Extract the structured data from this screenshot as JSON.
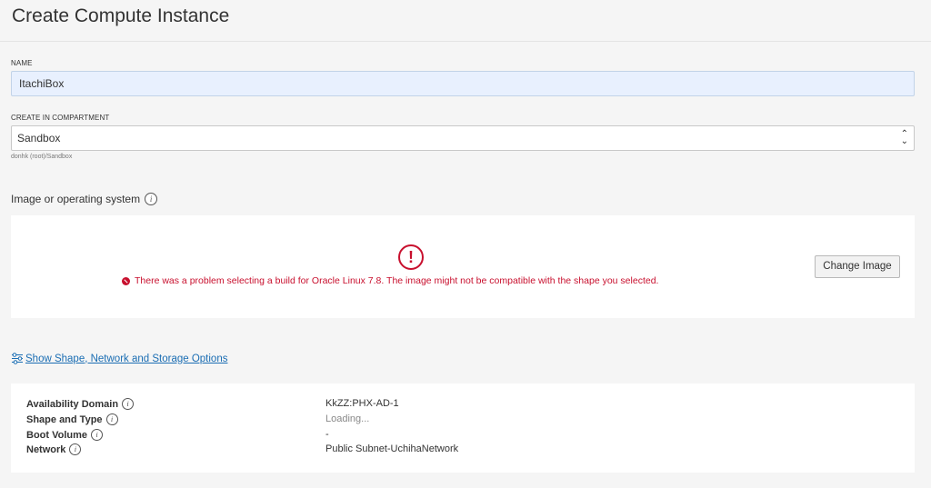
{
  "page": {
    "title": "Create Compute Instance"
  },
  "name_field": {
    "label": "NAME",
    "value": "ItachiBox"
  },
  "compartment": {
    "label": "CREATE IN COMPARTMENT",
    "selected": "Sandbox",
    "path": "donhk (root)/Sandbox"
  },
  "image_section": {
    "title": "Image or operating system",
    "error_icon": "exclamation-circle-icon",
    "error_message": "There was a problem selecting a build for Oracle Linux 7.8. The image might not be compatible with the shape you selected.",
    "change_button": "Change Image"
  },
  "options_link": {
    "icon": "sliders-icon",
    "label": "Show Shape, Network and Storage Options"
  },
  "summary": {
    "rows": [
      {
        "key": "Availability Domain",
        "value": "KkZZ:PHX-AD-1"
      },
      {
        "key": "Shape and Type",
        "value": "Loading..."
      },
      {
        "key": "Boot Volume",
        "value": "-"
      },
      {
        "key": "Network",
        "value": "Public Subnet-UchihaNetwork"
      }
    ]
  },
  "colors": {
    "error": "#c8102e",
    "link": "#1a6db3",
    "input_autofill": "#e8f0fe"
  }
}
